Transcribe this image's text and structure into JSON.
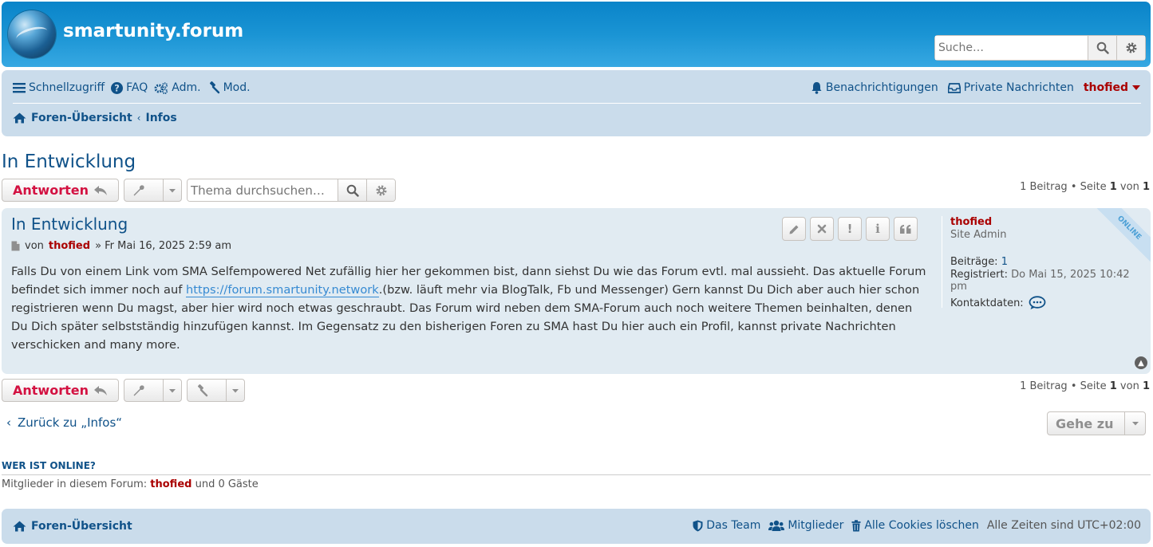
{
  "header": {
    "site_name": "smartunity.forum",
    "search_placeholder": "Suche…"
  },
  "nav": {
    "quick": "Schnellzugriff",
    "faq": "FAQ",
    "adm": "Adm.",
    "mod": "Mod.",
    "notifications": "Benachrichtigungen",
    "private_messages": "Private Nachrichten",
    "username": "thofied"
  },
  "breadcrumbs": {
    "home": "Foren-Übersicht",
    "forum": "Infos"
  },
  "topic": {
    "title": "In Entwicklung",
    "reply_label": "Antworten",
    "search_placeholder": "Thema durchsuchen…",
    "pagination": {
      "count": "1 Beitrag",
      "page_word": "Seite",
      "current": "1",
      "of_word": "von",
      "total": "1"
    }
  },
  "post": {
    "title": "In Entwicklung",
    "by": "von",
    "author": "thofied",
    "date": "» Fr Mai 16, 2025 2:59 am",
    "body_part1": "Falls Du von einem Link vom SMA Selfempowered Net zufällig hier her gekommen bist, dann siehst Du wie das Forum evtl. mal aussieht. Das aktuelle Forum befindet sich immer noch auf ",
    "body_link": "https://forum.smartunity.network",
    "body_part2": ".(bzw. läuft mehr via BlogTalk, Fb und Messenger) Gern kannst Du Dich aber auch hier schon registrieren wenn Du magst, aber hier wird noch etwas geschraubt. Das Forum wird neben dem SMA-Forum auch noch weitere Themen beinhalten, denen Du Dich später selbstständig hinzufügen kannst. Im Gegensatz zu den bisherigen Foren zu SMA hast Du hier auch ein Profil, kannst private Nachrichten verschicken and many more."
  },
  "profile": {
    "name": "thofied",
    "rank": "Site Admin",
    "posts_label": "Beiträge:",
    "posts_value": "1",
    "registered_label": "Registriert:",
    "registered_value": "Do Mai 15, 2025 10:42 pm",
    "contact_label": "Kontaktdaten:",
    "online_badge": "ONLINE"
  },
  "bottom": {
    "back_link": "Zurück zu „Infos“",
    "goto": "Gehe zu"
  },
  "online": {
    "heading": "WER IST ONLINE?",
    "prefix": "Mitglieder in diesem Forum:",
    "user": "thofied",
    "suffix": "und 0 Gäste"
  },
  "footer": {
    "home": "Foren-Übersicht",
    "team": "Das Team",
    "members": "Mitglieder",
    "cookies": "Alle Cookies löschen",
    "timezone": "Alle Zeiten sind UTC+02:00"
  },
  "colors": {
    "primary": "#105289",
    "accent_red": "#d31141",
    "user_red": "#aa0000",
    "nav_bg": "#cadceb",
    "post_bg": "#e1ebf2"
  }
}
